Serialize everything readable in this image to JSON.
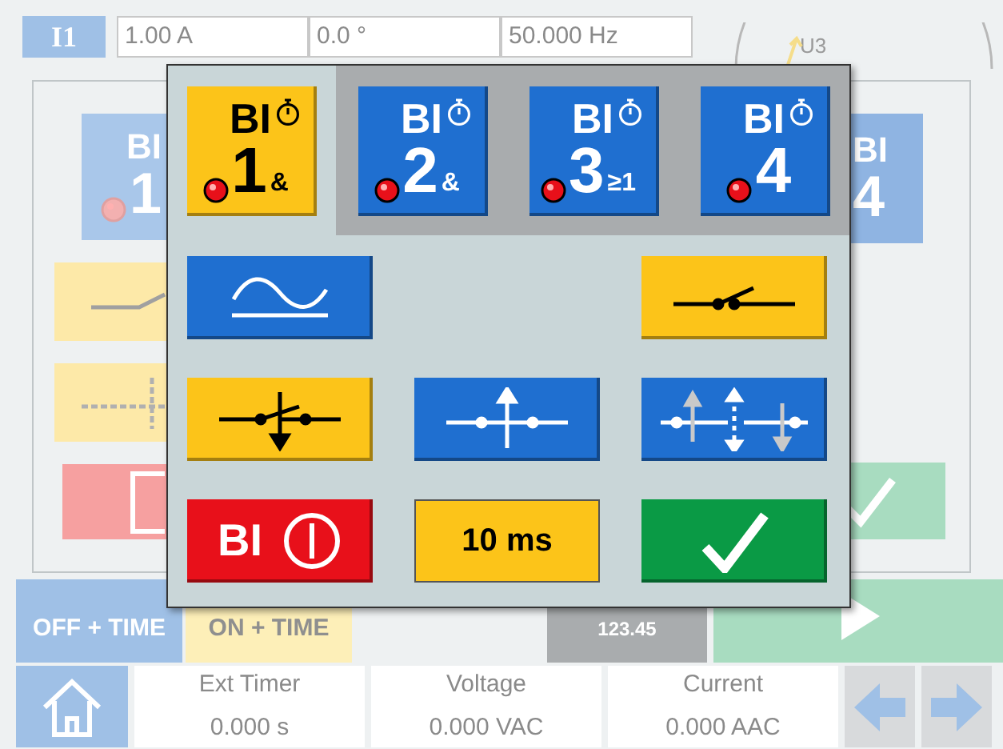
{
  "top_bar": {
    "channel": "I1",
    "fields": [
      "1.00 A",
      "0.0 °",
      "50.000 Hz"
    ]
  },
  "vector_diagram": {
    "label": "U3"
  },
  "background_panel": {
    "binary_inputs": [
      {
        "label": "BI",
        "number": "1"
      },
      {
        "label": "BI",
        "number": "4"
      }
    ]
  },
  "dialog": {
    "binary_inputs": [
      {
        "label": "BI",
        "number": "1",
        "logic": "&",
        "selected": true
      },
      {
        "label": "BI",
        "number": "2",
        "logic": "&",
        "selected": false
      },
      {
        "label": "BI",
        "number": "3",
        "logic": "≥1",
        "selected": false
      },
      {
        "label": "BI",
        "number": "4",
        "selected": false
      }
    ],
    "trigger_buttons": [
      {
        "kind": "wave",
        "selected": false
      },
      {
        "kind": "empty"
      },
      {
        "kind": "contact",
        "selected": true
      },
      {
        "kind": "falling",
        "selected": true
      },
      {
        "kind": "rising",
        "selected": false
      },
      {
        "kind": "both",
        "selected": false
      }
    ],
    "off_button": {
      "label": "BI"
    },
    "debounce_button": {
      "label": "10 ms"
    }
  },
  "mode_buttons": [
    {
      "label": "OFF + TIME",
      "selected": true
    },
    {
      "label": "ON + TIME",
      "selected": false
    }
  ],
  "manual_button": {
    "label": "123.45"
  },
  "status_bar": [
    {
      "label": "Ext Timer",
      "value": "0.000 s"
    },
    {
      "label": "Voltage",
      "value": "0.000 VAC"
    },
    {
      "label": "Current",
      "value": "0.000 AAC"
    }
  ]
}
